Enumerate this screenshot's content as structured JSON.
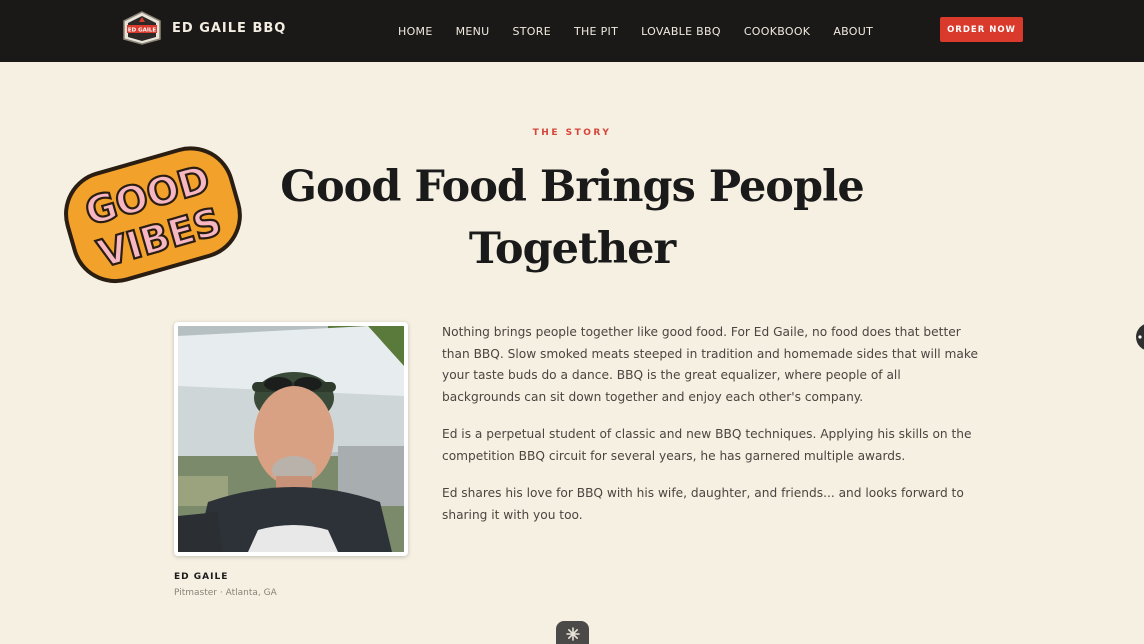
{
  "header": {
    "brand_name": "ED GAILE BBQ",
    "logo_text": "ED GAILE",
    "nav": [
      "HOME",
      "MENU",
      "STORE",
      "THE PIT",
      "LOVABLE BBQ",
      "COOKBOOK",
      "ABOUT"
    ],
    "cta_label": "ORDER NOW"
  },
  "sticker": {
    "line1": "GOOD",
    "line2": "VIBES"
  },
  "story": {
    "eyebrow": "THE STORY",
    "headline_line1": "Good Food Brings People",
    "headline_line2": "Together",
    "paragraphs": [
      "Nothing brings people together like good food. For Ed Gaile, no food does that better than BBQ. Slow smoked meats steeped in tradition and homemade sides that will make your taste buds do a dance. BBQ is the great equalizer, where people of all backgrounds can sit down together and enjoy each other's company.",
      "Ed is a perpetual student of classic and new BBQ techniques. Applying his skills on the competition BBQ circuit for several years, he has garnered multiple awards.",
      "Ed shares his love for BBQ with his wife, daughter, and friends... and looks forward to sharing it with you too."
    ],
    "photo_caption_name": "ED GAILE",
    "photo_caption_role": "Pitmaster · Atlanta, GA"
  },
  "colors": {
    "header_bg": "#1b1918",
    "page_bg": "#f6f0e3",
    "accent_red": "#d93a2c",
    "sticker_orange": "#f2a12b",
    "sticker_pink": "#f6b7c2"
  },
  "icons": {
    "side_handle": "chevron-left-icon",
    "scroll_hint": "asterisk-icon"
  }
}
